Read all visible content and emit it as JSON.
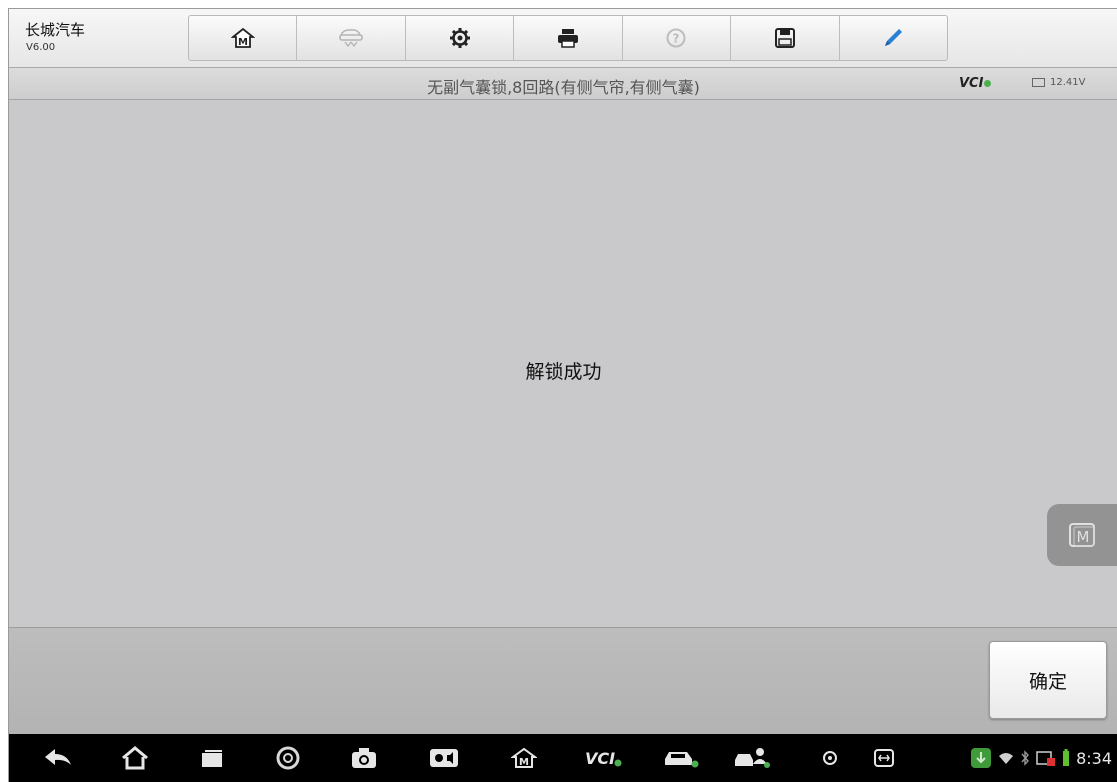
{
  "app": {
    "title": "长城汽车",
    "version": "V6.00"
  },
  "toolbar": {
    "buttons": [
      {
        "name": "home",
        "icon": "home-m-icon"
      },
      {
        "name": "vehicle-swap",
        "icon": "vehicle-swap-icon",
        "disabled": true
      },
      {
        "name": "settings",
        "icon": "gear-icon"
      },
      {
        "name": "print",
        "icon": "printer-icon"
      },
      {
        "name": "help",
        "icon": "help-icon",
        "disabled": true
      },
      {
        "name": "save",
        "icon": "save-icon"
      },
      {
        "name": "edit",
        "icon": "pen-icon"
      }
    ]
  },
  "subbar": {
    "title": "无副气囊锁,8回路(有侧气帘,有侧气囊)",
    "vci_label": "VCI",
    "voltage": "12.41V"
  },
  "main": {
    "message": "解锁成功"
  },
  "actions": {
    "ok_label": "确定"
  },
  "statusbar": {
    "time": "8:34"
  },
  "colors": {
    "accent_blue": "#2a7fd6",
    "vci_connected": "#4caf50",
    "background": "#c9c9cb"
  }
}
